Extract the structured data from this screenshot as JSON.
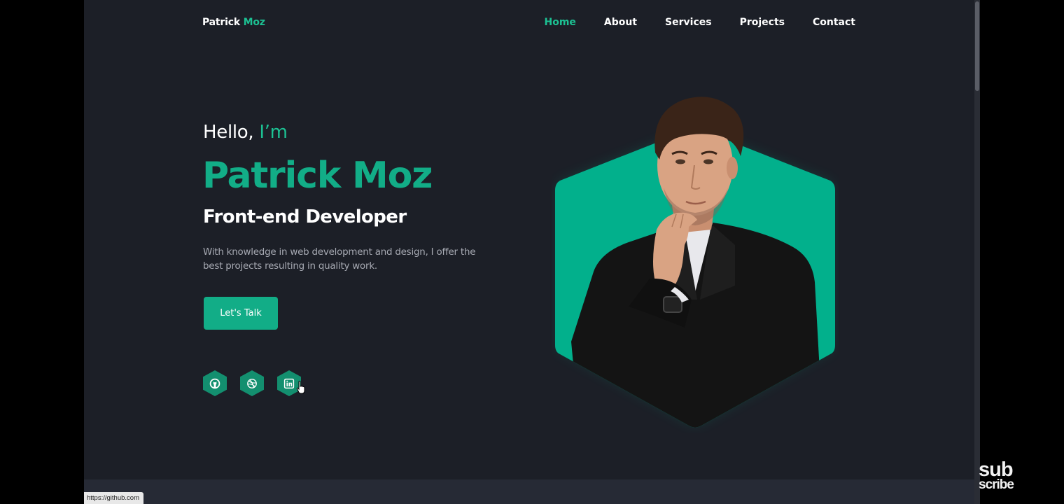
{
  "header": {
    "logo_first": "Patrick",
    "logo_second": "Moz",
    "nav": [
      "Home",
      "About",
      "Services",
      "Projects",
      "Contact"
    ],
    "active_nav": "Home"
  },
  "hero": {
    "greeting_prefix": "Hello,",
    "greeting_accent": "I’m",
    "name": "Patrick Moz",
    "role": "Front-end Developer",
    "description": "With knowledge in web development and design, I offer the best projects resulting in quality work.",
    "cta_label": "Let's Talk"
  },
  "social": [
    {
      "icon": "github-icon"
    },
    {
      "icon": "dribbble-icon"
    },
    {
      "icon": "linkedin-icon"
    }
  ],
  "status_bar": {
    "url": "https://github.com"
  },
  "watermark": {
    "line1": "sub",
    "line2": "scribe"
  },
  "colors": {
    "accent": "#12ad87",
    "accent_light": "#1cc193",
    "background": "#1c1f27",
    "text": "#ffffff",
    "muted_text": "#a7aab3"
  }
}
